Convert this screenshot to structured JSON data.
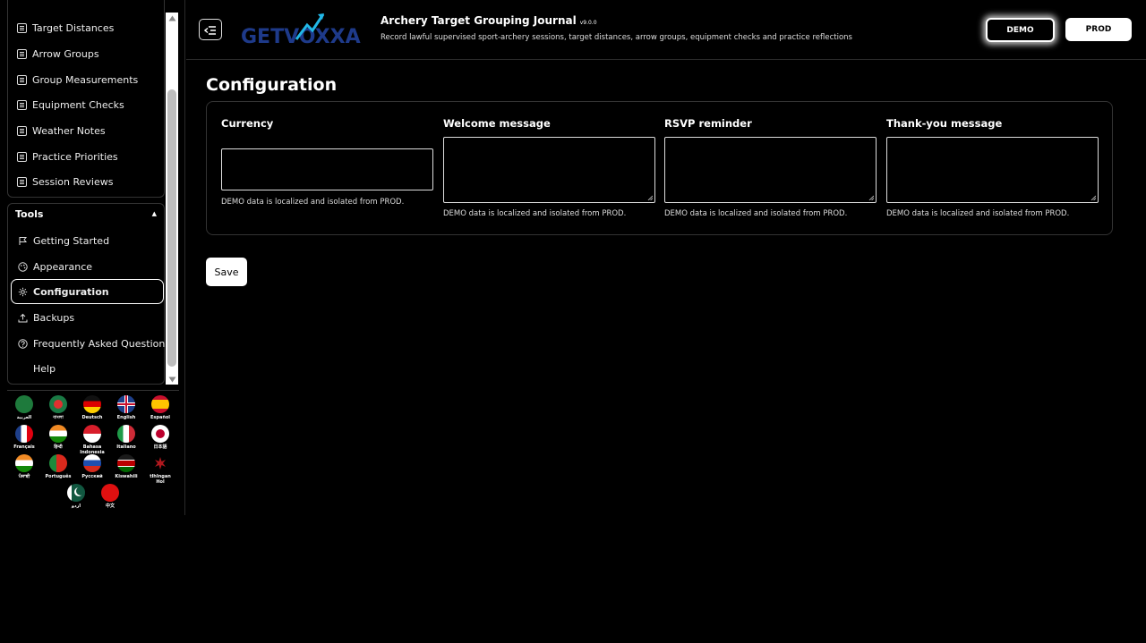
{
  "app": {
    "logo_text": "GETVOXXA",
    "title": "Archery Target Grouping Journal",
    "version": "v9.0.0",
    "description": "Record lawful supervised sport-archery sessions, target distances, arrow groups, equipment checks and practice reflections",
    "env_demo": "DEMO",
    "env_prod": "PROD"
  },
  "sidebar": {
    "items": [
      {
        "label": "Target Distances",
        "icon": "list-icon"
      },
      {
        "label": "Arrow Groups",
        "icon": "list-icon"
      },
      {
        "label": "Group Measurements",
        "icon": "list-icon"
      },
      {
        "label": "Equipment Checks",
        "icon": "list-icon"
      },
      {
        "label": "Weather Notes",
        "icon": "list-icon"
      },
      {
        "label": "Practice Priorities",
        "icon": "list-icon"
      },
      {
        "label": "Session Reviews",
        "icon": "list-icon"
      }
    ],
    "tools_label": "Tools",
    "tools": [
      {
        "label": "Getting Started",
        "icon": "flag-icon"
      },
      {
        "label": "Appearance",
        "icon": "palette-icon"
      },
      {
        "label": "Configuration",
        "icon": "gear-icon",
        "active": true
      },
      {
        "label": "Backups",
        "icon": "upload-icon"
      },
      {
        "label": "Frequently Asked Questions",
        "icon": "help-icon"
      },
      {
        "label": "Help",
        "icon": ""
      }
    ]
  },
  "languages": [
    {
      "label": "العربية",
      "color": "#1e7a3c"
    },
    {
      "label": "বাংলা",
      "color": "#1a7a45"
    },
    {
      "label": "Deutsch",
      "color": "#dd0000"
    },
    {
      "label": "English",
      "color": "#1e3f8a"
    },
    {
      "label": "Español",
      "color": "#c8102e"
    },
    {
      "label": "Français",
      "color": "#1e3f8a"
    },
    {
      "label": "हिन्दी",
      "color": "#f08a24"
    },
    {
      "label": "Bahasa Indonesia",
      "color": "#d81e2b"
    },
    {
      "label": "Italiano",
      "color": "#1f9a48"
    },
    {
      "label": "日本語",
      "color": "#ffffff"
    },
    {
      "label": "ਪੰਜਾਬੀ",
      "color": "#f08a24"
    },
    {
      "label": "Português",
      "color": "#1f8a3c"
    },
    {
      "label": "Русский",
      "color": "#1e4fb0"
    },
    {
      "label": "Kiswahili",
      "color": "#1a1a1a"
    },
    {
      "label": "tlhIngan Hol",
      "color": "#000000"
    },
    {
      "label": "اردو",
      "color": "#115740"
    },
    {
      "label": "中文",
      "color": "#e01010"
    }
  ],
  "main": {
    "title": "Configuration",
    "fields": [
      {
        "label": "Currency",
        "value": "",
        "hint": "DEMO data is localized and isolated from PROD."
      },
      {
        "label": "Welcome message",
        "value": "",
        "hint": "DEMO data is localized and isolated from PROD."
      },
      {
        "label": "RSVP reminder",
        "value": "",
        "hint": "DEMO data is localized and isolated from PROD."
      },
      {
        "label": "Thank-you message",
        "value": "",
        "hint": "DEMO data is localized and isolated from PROD."
      }
    ],
    "save_label": "Save"
  }
}
